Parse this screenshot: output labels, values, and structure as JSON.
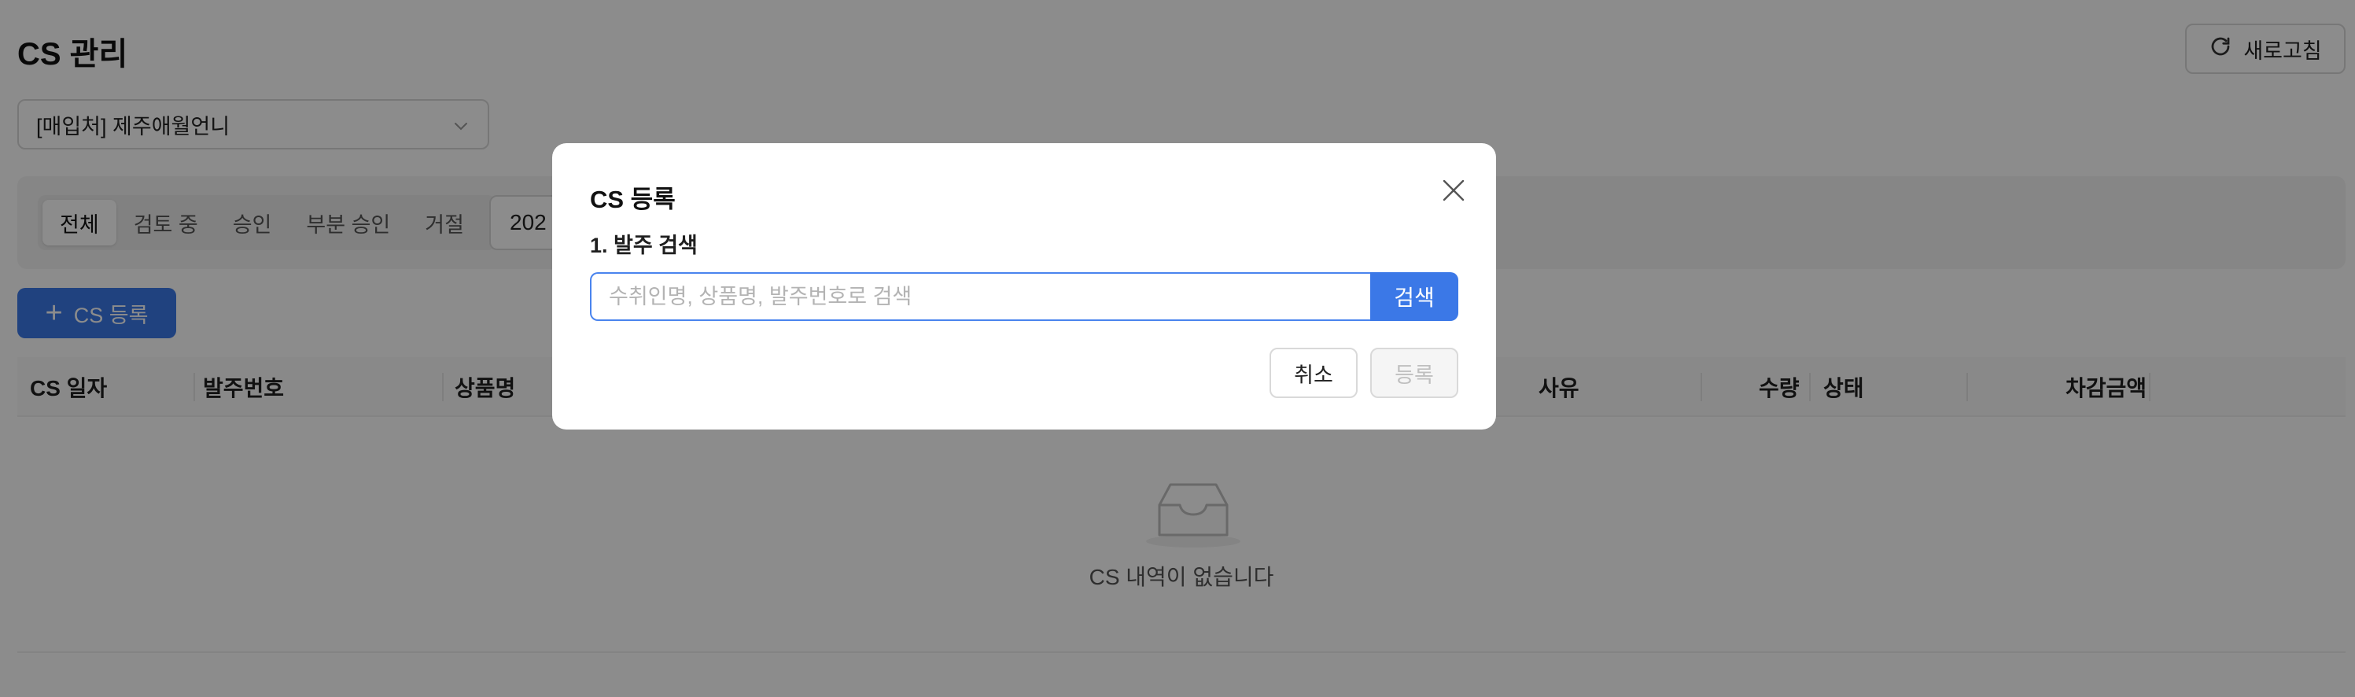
{
  "page": {
    "title": "CS 관리",
    "refresh_label": "새로고침",
    "supplier_value": "[매입처] 제주애월언니"
  },
  "filters": {
    "tabs": [
      "전체",
      "검토 중",
      "승인",
      "부분 승인",
      "거절"
    ],
    "active_tab": "전체",
    "date_partial": "202"
  },
  "actions": {
    "add_label": "CS 등록"
  },
  "table": {
    "columns": [
      "CS 일자",
      "발주번호",
      "상품명",
      "사유",
      "수량",
      "상태",
      "차감금액"
    ],
    "empty_text": "CS 내역이 없습니다"
  },
  "modal": {
    "title": "CS 등록",
    "step_label": "1. 발주 검색",
    "search_placeholder": "수취인명, 상품명, 발주번호로 검색",
    "search_value": "",
    "search_button": "검색",
    "cancel_button": "취소",
    "submit_button": "등록"
  },
  "icons": {
    "refresh": "refresh-icon",
    "dropdown": "chevron-down-icon",
    "add": "plus-icon",
    "empty": "inbox-empty-icon",
    "close": "close-icon"
  },
  "colors": {
    "primary": "#3b78e7",
    "overlay": "rgba(0,0,0,0.45)"
  }
}
